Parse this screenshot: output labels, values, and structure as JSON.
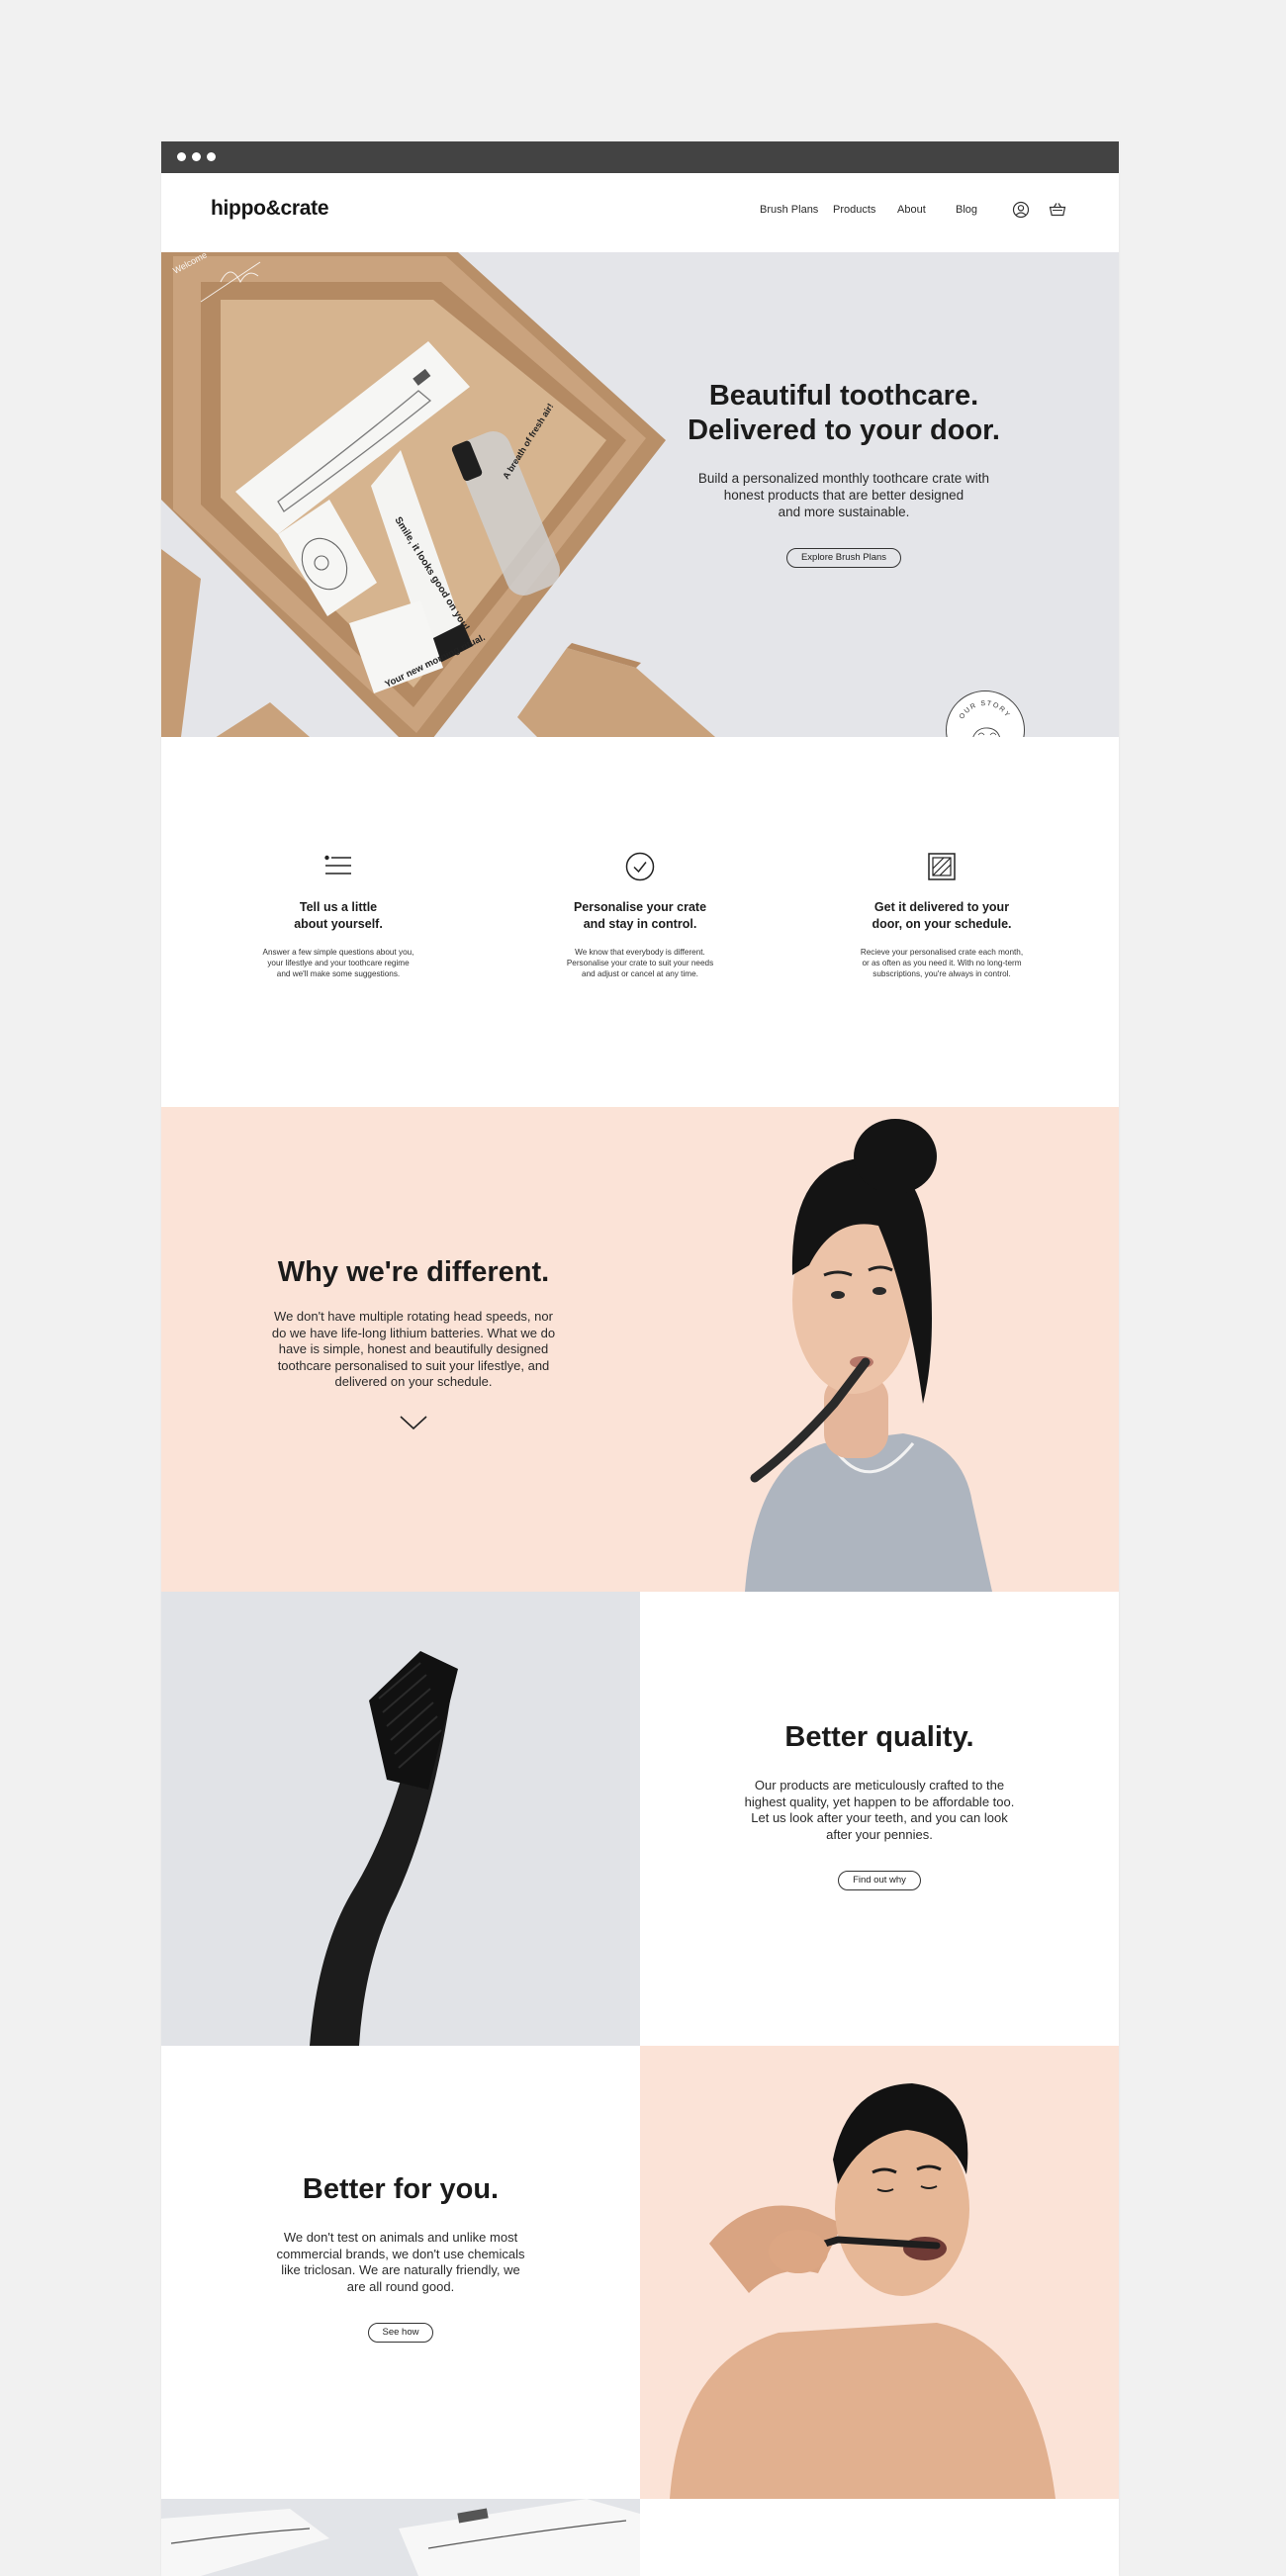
{
  "brand": {
    "logo": "hippo&crate"
  },
  "nav": {
    "links": [
      "Brush Plans",
      "Products",
      "About",
      "Blog"
    ],
    "account_icon": "user-icon",
    "cart_icon": "basket-icon"
  },
  "hero": {
    "title_line1": "Beautiful toothcare.",
    "title_line2": "Delivered to your door.",
    "subtitle_line1": "Build a personalized monthly toothcare crate with",
    "subtitle_line2": "honest products that are better designed",
    "subtitle_line3": "and more sustainable.",
    "cta": "Explore Brush Plans",
    "box_card_1": "Smile, it looks good on you!",
    "box_card_2": "A breath of fresh air!",
    "box_card_3": "Your new morning ritual.",
    "box_lid_text": "Welcome",
    "story_badge": "OUR STORY"
  },
  "steps": [
    {
      "icon": "list-icon",
      "title_1": "Tell us a little",
      "title_2": "about yourself.",
      "text_1": "Answer a few simple questions about you,",
      "text_2": "your lifestlye and your toothcare regime",
      "text_3": "and we'll make some suggestions."
    },
    {
      "icon": "check-circle-icon",
      "title_1": "Personalise your crate",
      "title_2": "and stay in control.",
      "text_1": "We know that everybody is different.",
      "text_2": "Personalise your crate to suit your needs",
      "text_3": "and  adjust or cancel at any time."
    },
    {
      "icon": "crate-icon",
      "title_1": "Get it delivered to your",
      "title_2": "door, on your schedule.",
      "text_1": "Recieve your personalised crate each month,",
      "text_2": "or as often as you need it. With no long-term",
      "text_3": "subscriptions, you're always in control."
    }
  ],
  "different": {
    "title": "Why we're different.",
    "l1": "We don't have multiple rotating head speeds, nor",
    "l2": "do we have life-long lithium batteries. What we do",
    "l3": "have is simple, honest and beautifully designed",
    "l4": "toothcare personalised to suit your lifestlye, and",
    "l5": "delivered on your schedule."
  },
  "quality": {
    "title": "Better quality.",
    "l1": "Our products are meticulously crafted to the",
    "l2": "highest quality, yet happen to be affordable too.",
    "l3": "Let us look after your teeth, and you can look",
    "l4": "after your pennies.",
    "cta": "Find out why"
  },
  "foryou": {
    "title": "Better for you.",
    "l1": "We don't test on animals and unlike most",
    "l2": "commercial brands, we don't use chemicals",
    "l3": "like triclosan. We are naturally friendly, we",
    "l4": "are all round good.",
    "cta": "See how"
  },
  "colors": {
    "peach": "#fbe3d7",
    "grey_bg": "#e4e5e9",
    "chrome": "#434343",
    "kraft": "#c9a27c"
  }
}
